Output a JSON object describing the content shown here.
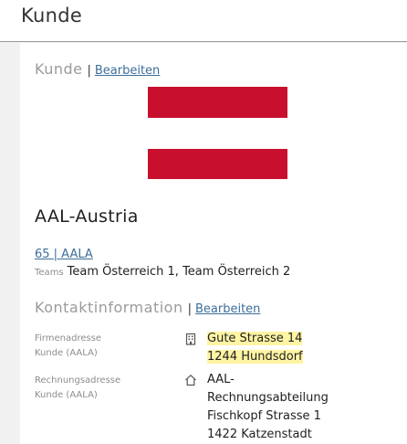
{
  "header": {
    "title": "Kunde"
  },
  "customer_section": {
    "title": "Kunde",
    "separator": "|",
    "edit_label": "Bearbeiten",
    "flag_colors": [
      "#c8102e",
      "#ffffff",
      "#c8102e"
    ],
    "name": "AAL-Austria",
    "number_link": "65 | AALA",
    "teams_label": "Teams",
    "teams_value": "Team Österreich 1, Team Österreich 2"
  },
  "contact_section": {
    "title": "Kontaktinformation",
    "separator": "|",
    "edit_label": "Bearbeiten",
    "company_address": {
      "label_line1": "Firmenadresse",
      "label_line2": "Kunde (AALA)",
      "icon": "building-icon",
      "lines": [
        "Gute Strasse 14",
        "1244 Hundsdorf"
      ],
      "highlight_color": "#fff4a3"
    },
    "billing_address": {
      "label_line1": "Rechnungsadresse",
      "label_line2": "Kunde (AALA)",
      "icon": "home-icon",
      "lines": [
        "AAL-",
        "Rechnungsabteilung",
        "Fischkopf Strasse 1",
        "1422 Katzenstadt"
      ]
    }
  }
}
